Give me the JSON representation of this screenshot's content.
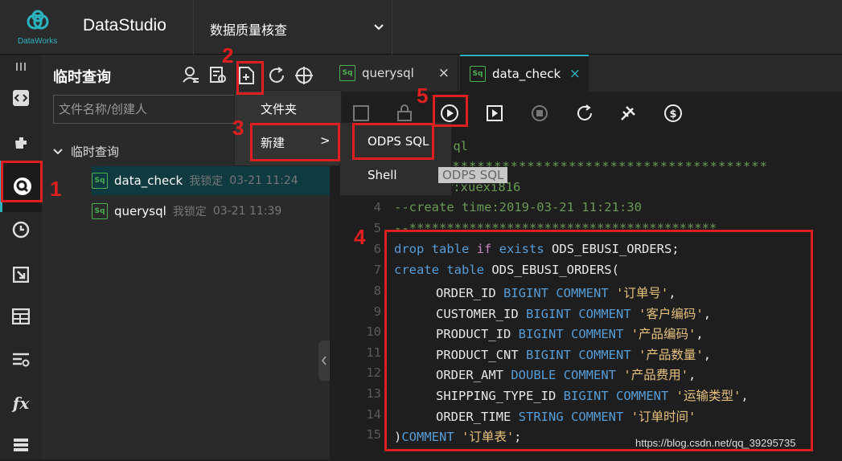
{
  "header": {
    "logo_text": "DataWorks",
    "brand": "DataStudio",
    "project": "数据质量核查"
  },
  "explorer": {
    "title": "临时查询",
    "search_placeholder": "文件名称/创建人",
    "folder": "临时查询",
    "files": [
      {
        "icon": "Sq",
        "name": "data_check",
        "lock": "我锁定",
        "time": "03-21 11:24"
      },
      {
        "icon": "Sq",
        "name": "querysql",
        "lock": "我锁定",
        "time": "03-21 11:39"
      }
    ]
  },
  "tabs": [
    {
      "icon": "Sq",
      "label": "querysql",
      "close": "×"
    },
    {
      "icon": "Sq",
      "label": "data_check",
      "close": "×"
    }
  ],
  "context_menu": {
    "folder": "文件夹",
    "new": "新建",
    "arrow": ">",
    "submenu": [
      "ODPS SQL",
      "Shell"
    ]
  },
  "tooltip": "ODPS SQL",
  "editor": {
    "partial_header": "sql",
    "partial_author": "r:xuexi816",
    "lines": [
      {
        "n": "4",
        "text": "--create time:2019-03-21 11:21:30"
      },
      {
        "n": "5",
        "text": "--*****************************************"
      },
      {
        "n": "6",
        "text": "drop table if exists ODS_EBUSI_ORDERS;"
      },
      {
        "n": "7",
        "text": "create table ODS_EBUSI_ORDERS("
      },
      {
        "n": "8",
        "col": "ORDER_ID",
        "type": "BIGINT",
        "comment_kw": "COMMENT",
        "str": "'订单号'",
        "end": ","
      },
      {
        "n": "9",
        "col": "CUSTOMER_ID",
        "type": "BIGINT",
        "comment_kw": "COMMENT",
        "str": "'客户编码'",
        "end": ","
      },
      {
        "n": "10",
        "col": "PRODUCT_ID",
        "type": "BIGINT",
        "comment_kw": "COMMENT",
        "str": "'产品编码'",
        "end": ","
      },
      {
        "n": "11",
        "col": "PRODUCT_CNT",
        "type": "BIGINT",
        "comment_kw": "COMMENT",
        "str": "'产品数量'",
        "end": ","
      },
      {
        "n": "12",
        "col": "ORDER_AMT",
        "type": "DOUBLE",
        "comment_kw": "COMMENT",
        "str": "'产品费用'",
        "end": ","
      },
      {
        "n": "13",
        "col": "SHIPPING_TYPE_ID",
        "type": "BIGINT",
        "comment_kw": "COMMENT",
        "str": "'运输类型'",
        "end": ","
      },
      {
        "n": "14",
        "col": "ORDER_TIME",
        "type": "STRING",
        "comment_kw": "COMMENT",
        "str": "'订单时间'",
        "end": ""
      },
      {
        "n": "15",
        "text": ")COMMENT '订单表';"
      }
    ]
  },
  "annotations": [
    "1",
    "2",
    "3",
    "4",
    "5"
  ],
  "watermark": "https://blog.csdn.net/qq_39295735",
  "colors": {
    "accent": "#2bb3c0",
    "annotation": "#e02020",
    "sq_icon": "#4caf50"
  }
}
